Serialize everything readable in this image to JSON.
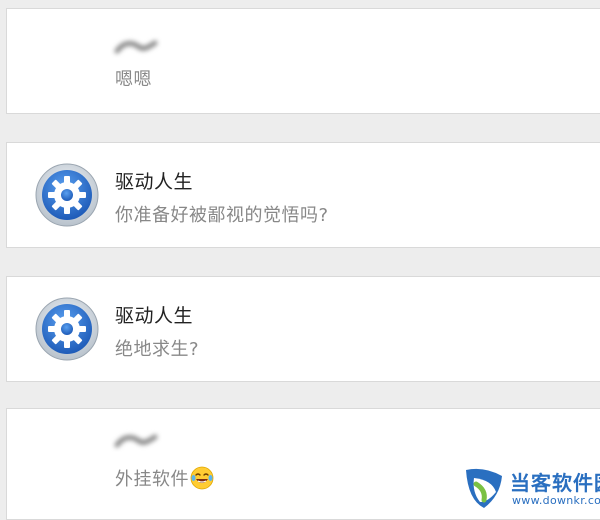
{
  "messages": [
    {
      "sender": "",
      "text": "嗯嗯",
      "avatar": "none",
      "sender_blurred": true
    },
    {
      "sender": "驱动人生",
      "text": "你准备好被鄙视的觉悟吗?",
      "avatar": "blue-gear-icon"
    },
    {
      "sender": "驱动人生",
      "text": "绝地求生?",
      "avatar": "blue-gear-icon"
    },
    {
      "sender": "",
      "text": "外挂软件",
      "emoji": "laughing-tears-emoji",
      "avatar": "none",
      "sender_blurred": true
    }
  ],
  "watermark": {
    "title": "当客软件园",
    "url": "www.downkr.com",
    "logo": "downkr-logo-icon"
  },
  "colors": {
    "background": "#ededed",
    "card": "#ffffff",
    "name_text": "#222222",
    "message_text": "#888888",
    "gear_blue": "#2f6fd0",
    "watermark_blue": "#2a6fc0",
    "watermark_green": "#7ac143"
  }
}
